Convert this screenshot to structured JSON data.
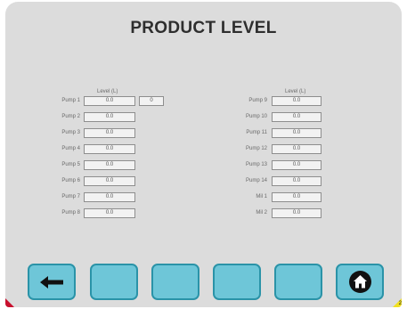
{
  "title": "PRODUCT LEVEL",
  "left_panel": {
    "header": "Level (L)",
    "rows": [
      {
        "label": "Pump 1",
        "value": "0.0",
        "extra": "0"
      },
      {
        "label": "Pump 2",
        "value": "0.0"
      },
      {
        "label": "Pump 3",
        "value": "0.0"
      },
      {
        "label": "Pump 4",
        "value": "0.0"
      },
      {
        "label": "Pump 5",
        "value": "0.0"
      },
      {
        "label": "Pump 6",
        "value": "0.0"
      },
      {
        "label": "Pump 7",
        "value": "0.0"
      },
      {
        "label": "Pump 8",
        "value": "0.0"
      }
    ]
  },
  "right_panel": {
    "header": "Level (L)",
    "rows": [
      {
        "label": "Pump 9",
        "value": "0.0"
      },
      {
        "label": "Pump 10",
        "value": "0.0"
      },
      {
        "label": "Pump 11",
        "value": "0.0"
      },
      {
        "label": "Pump 12",
        "value": "0.0"
      },
      {
        "label": "Pump 13",
        "value": "0.0"
      },
      {
        "label": "Pump 14",
        "value": "0.0"
      },
      {
        "label": "Mil 1",
        "value": "0.0"
      },
      {
        "label": "Mil 2",
        "value": "0.0"
      }
    ]
  },
  "bottom_bar": {
    "buttons": [
      {
        "name": "back-button",
        "icon": "arrow-left-icon"
      },
      {
        "name": "blank-button-1",
        "icon": ""
      },
      {
        "name": "blank-button-2",
        "icon": ""
      },
      {
        "name": "blank-button-3",
        "icon": ""
      },
      {
        "name": "blank-button-4",
        "icon": ""
      },
      {
        "name": "home-button",
        "icon": "home-icon"
      }
    ]
  },
  "corner_indicator": "2",
  "colors": {
    "screen_bg": "#dcdcdc",
    "button_fill": "#6ec6d8",
    "button_border": "#2a93a8",
    "corner_red": "#c8102e",
    "corner_yellow": "#f0e020"
  }
}
